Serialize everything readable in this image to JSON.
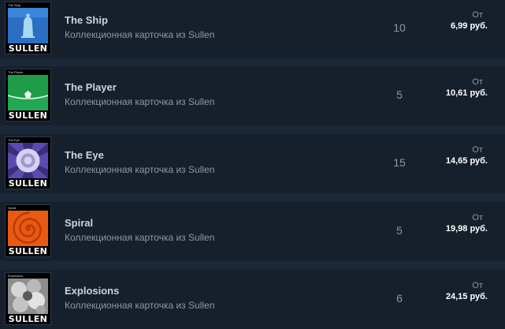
{
  "listings": [
    {
      "card_label": "The Ship",
      "card_logo": "SULLEN",
      "art": "ship-bell-icon",
      "name": "The Ship",
      "subtitle": "Коллекционная карточка из Sullen",
      "quantity": "10",
      "price_prefix": "От",
      "price": "6,99 руб."
    },
    {
      "card_label": "The Player",
      "card_logo": "SULLEN",
      "art": "player-field-icon",
      "name": "The Player",
      "subtitle": "Коллекционная карточка из Sullen",
      "quantity": "5",
      "price_prefix": "От",
      "price": "10,61 руб."
    },
    {
      "card_label": "The Eye",
      "card_logo": "SULLEN",
      "art": "eye-icon",
      "name": "The Eye",
      "subtitle": "Коллекционная карточка из Sullen",
      "quantity": "15",
      "price_prefix": "От",
      "price": "14,65 руб."
    },
    {
      "card_label": "Spiral",
      "card_logo": "SULLEN",
      "art": "spiral-icon",
      "name": "Spiral",
      "subtitle": "Коллекционная карточка из Sullen",
      "quantity": "5",
      "price_prefix": "От",
      "price": "19,98 руб."
    },
    {
      "card_label": "Explosions",
      "card_logo": "SULLEN",
      "art": "explosion-icon",
      "name": "Explosions",
      "subtitle": "Коллекционная карточка из Sullen",
      "quantity": "6",
      "price_prefix": "От",
      "price": "24,15 руб."
    }
  ],
  "colors": {
    "page_background": "#1b2838",
    "row_background": "#16202d",
    "title_text": "#c7d5e0",
    "muted_text": "#8f98a0",
    "price_text": "#ffffff"
  }
}
